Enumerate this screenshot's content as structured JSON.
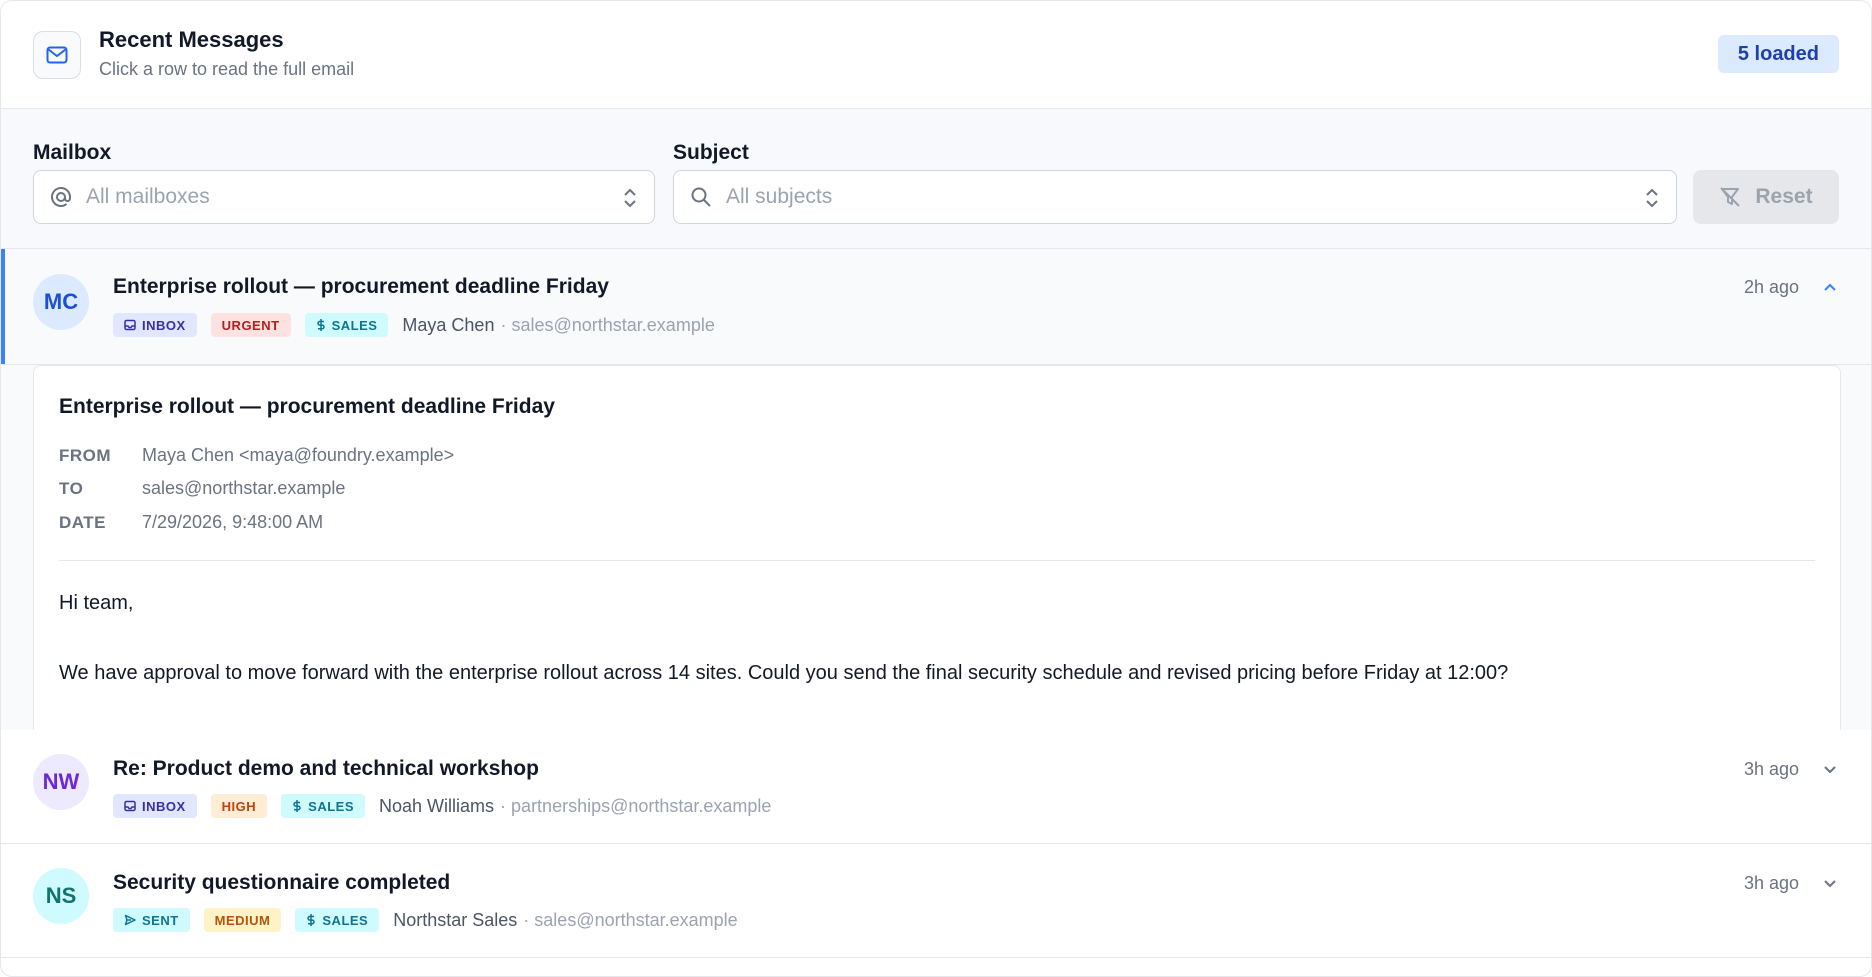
{
  "header": {
    "title": "Recent Messages",
    "subtitle": "Click a row to read the full email",
    "loaded_badge": "5 loaded"
  },
  "filters": {
    "mailbox": {
      "label": "Mailbox",
      "placeholder": "All mailboxes"
    },
    "subject": {
      "label": "Subject",
      "placeholder": "All subjects"
    },
    "reset_label": "Reset"
  },
  "colors": {
    "accent": "#3b82f6",
    "inbox_tag_bg": "#e0e7ff",
    "inbox_tag_fg": "#3730a3",
    "urgent_bg": "#fee2e2",
    "urgent_fg": "#b91c1c",
    "high_bg": "#ffedd5",
    "high_fg": "#c2410c",
    "medium_bg": "#fef3c7",
    "medium_fg": "#b45309",
    "sales_bg": "#cffafe",
    "sales_fg": "#0e7490",
    "sent_bg": "#cffafe",
    "sent_fg": "#0e7490"
  },
  "messages": [
    {
      "initials": "MC",
      "subject": "Enterprise rollout — procurement deadline Friday",
      "tags": [
        "INBOX",
        "URGENT",
        "SALES"
      ],
      "sender": "Maya Chen",
      "address": "· sales@northstar.example",
      "time": "2h ago",
      "expanded": true
    },
    {
      "initials": "NW",
      "subject": "Re: Product demo and technical workshop",
      "tags": [
        "INBOX",
        "HIGH",
        "SALES"
      ],
      "sender": "Noah Williams",
      "address": "· partnerships@northstar.example",
      "time": "3h ago",
      "expanded": false
    },
    {
      "initials": "NS",
      "subject": "Security questionnaire completed",
      "tags": [
        "SENT",
        "MEDIUM",
        "SALES"
      ],
      "sender": "Northstar Sales",
      "address": "· sales@northstar.example",
      "time": "3h ago",
      "expanded": false
    }
  ],
  "detail": {
    "subject": "Enterprise rollout — procurement deadline Friday",
    "from_label": "FROM",
    "from": "Maya Chen <maya@foundry.example>",
    "to_label": "TO",
    "to": "sales@northstar.example",
    "date_label": "DATE",
    "date": "7/29/2026, 9:48:00 AM",
    "greeting": "Hi team,",
    "body": "We have approval to move forward with the enterprise rollout across 14 sites. Could you send the final security schedule and revised pricing before Friday at 12:00?"
  }
}
